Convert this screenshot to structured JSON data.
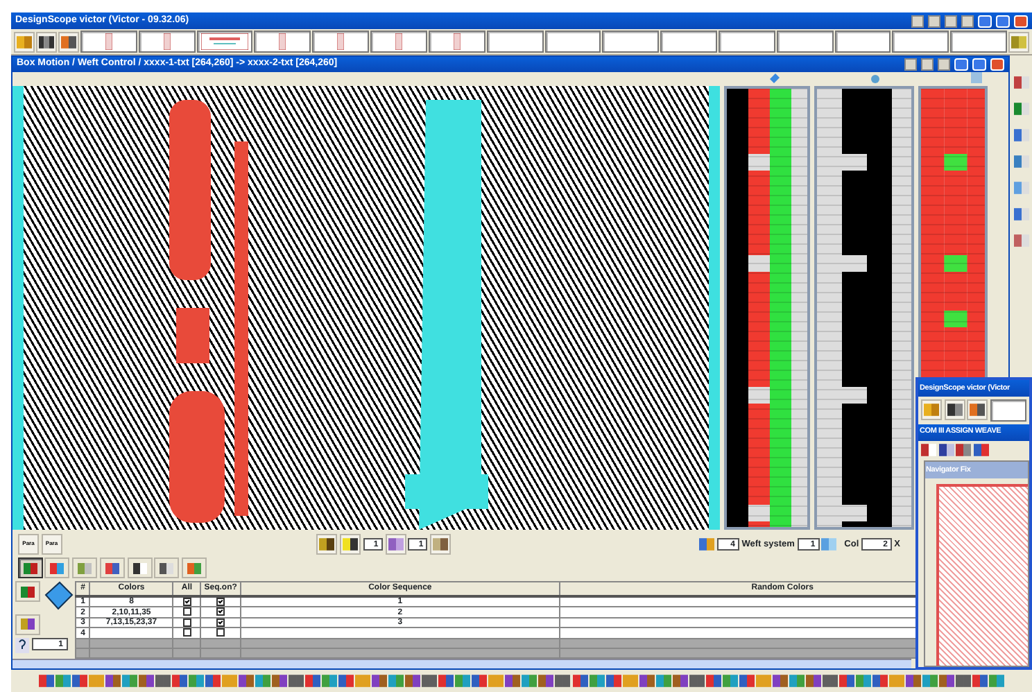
{
  "main_window": {
    "title": "DesignScope victor (Victor - 09.32.06)"
  },
  "toolbar": {
    "slots": [
      {
        "kind": "thumbnail"
      },
      {
        "kind": "thumbnail"
      },
      {
        "kind": "preview"
      },
      {
        "kind": "thumbnail"
      },
      {
        "kind": "thumbnail"
      },
      {
        "kind": "thumbnail"
      },
      {
        "kind": "thumbnail"
      },
      {
        "kind": "empty"
      },
      {
        "kind": "empty"
      },
      {
        "kind": "empty"
      },
      {
        "kind": "empty"
      },
      {
        "kind": "empty"
      },
      {
        "kind": "empty"
      },
      {
        "kind": "empty"
      },
      {
        "kind": "empty"
      },
      {
        "kind": "empty"
      }
    ]
  },
  "child_window": {
    "title": "Box Motion / Weft Control / xxxx-1-txt [264,260] -> xxxx-2-txt [264,260]"
  },
  "bottom_panel": {
    "para_buttons": [
      "Para",
      "Para"
    ],
    "yarn_field": "1",
    "grid_field": "1",
    "weft_count": "4",
    "weft_system_label": "Weft system",
    "weft_system": "1",
    "col_label": "Col",
    "col": "2",
    "close_mark": "X",
    "help_field": "1"
  },
  "view_tabs": [
    {
      "selected": true
    },
    {
      "selected": false
    },
    {
      "selected": false
    },
    {
      "selected": false
    },
    {
      "selected": false
    },
    {
      "selected": false
    },
    {
      "selected": false
    }
  ],
  "color_table": {
    "columns": [
      "#",
      "Colors",
      "All",
      "Seq.on?",
      "Color Sequence",
      "Random Colors"
    ],
    "rows": [
      {
        "number": "1",
        "colors": "8",
        "all": true,
        "seq_on": true,
        "sequence": "1"
      },
      {
        "number": "2",
        "colors": "2,10,11,35",
        "all": false,
        "seq_on": true,
        "sequence": "2"
      },
      {
        "number": "3",
        "colors": "7,13,15,23,37",
        "all": false,
        "seq_on": true,
        "sequence": "3"
      },
      {
        "number": "4",
        "colors": "",
        "all": false,
        "seq_on": false,
        "sequence": ""
      }
    ]
  },
  "overlay_window": {
    "title": "DesignScope victor (Victor",
    "child_title": "COM III  ASSIGN WEAVE",
    "navigator_title": "Navigator Fix"
  }
}
